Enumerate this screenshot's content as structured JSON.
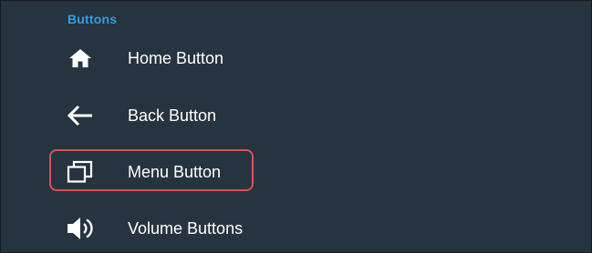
{
  "section": {
    "title": "Buttons"
  },
  "items": [
    {
      "label": "Home Button",
      "icon": "home-icon"
    },
    {
      "label": "Back Button",
      "icon": "back-arrow-icon"
    },
    {
      "label": "Menu Button",
      "icon": "recent-apps-icon"
    },
    {
      "label": "Volume Buttons",
      "icon": "volume-icon"
    }
  ],
  "colors": {
    "background": "#263340",
    "accent": "#2f9fe0",
    "text": "#ffffff",
    "highlight_border": "#d9534f"
  }
}
